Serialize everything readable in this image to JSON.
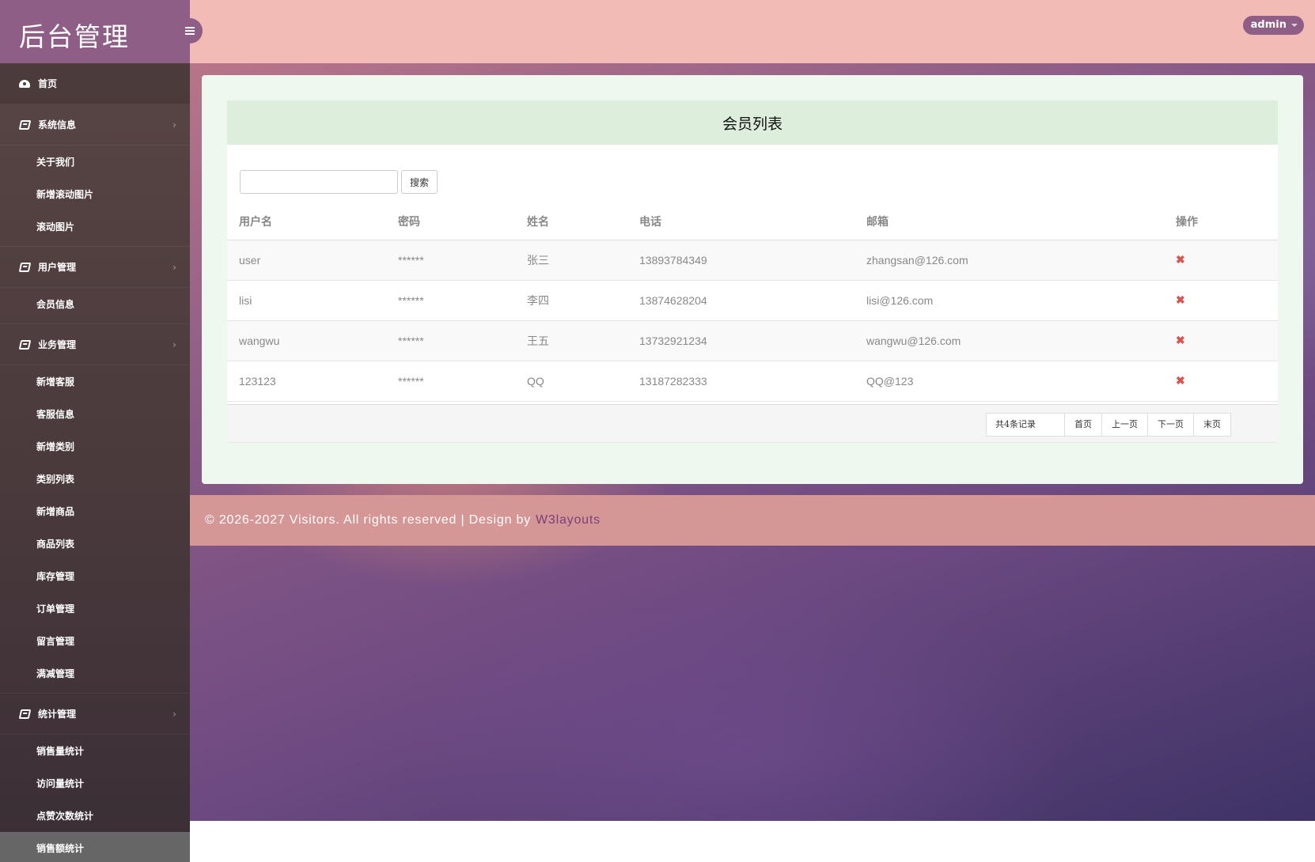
{
  "brand": "后台管理",
  "header": {
    "user": "admin"
  },
  "nav": {
    "home": "首页",
    "groups": [
      {
        "label": "系统信息",
        "items": [
          "关于我们",
          "新增滚动图片",
          "滚动图片"
        ]
      },
      {
        "label": "用户管理",
        "items": [
          "会员信息"
        ]
      },
      {
        "label": "业务管理",
        "items": [
          "新增客服",
          "客服信息",
          "新增类别",
          "类别列表",
          "新增商品",
          "商品列表",
          "库存管理",
          "订单管理",
          "留言管理",
          "满减管理"
        ]
      },
      {
        "label": "统计管理",
        "items": [
          "销售量统计",
          "访问量统计",
          "点赞次数统计",
          "销售额统计"
        ]
      }
    ]
  },
  "card": {
    "title": "会员列表",
    "search_button": "搜索",
    "search_placeholder": "",
    "columns": [
      "用户名",
      "密码",
      "姓名",
      "电话",
      "邮箱",
      "操作"
    ],
    "rows": [
      [
        "user",
        "******",
        "张三",
        "13893784349",
        "zhangsan@126.com"
      ],
      [
        "lisi",
        "******",
        "李四",
        "13874628204",
        "lisi@126.com"
      ],
      [
        "wangwu",
        "******",
        "王五",
        "13732921234",
        "wangwu@126.com"
      ],
      [
        "123123",
        "******",
        "QQ",
        "13187282333",
        "QQ@123"
      ]
    ],
    "delete_symbol": "✖"
  },
  "pager": {
    "count": "共4条记录",
    "first": "首页",
    "prev": "上一页",
    "next": "下一页",
    "last": "末页"
  },
  "footer": {
    "text": "© 2026-2027 Visitors. All rights reserved | Design by",
    "link": "W3layouts",
    "link_color": "#7b3f7a"
  },
  "colors": {
    "brand_bg": "#8e5e87",
    "header_bg": "#f2bbb5",
    "footer_bg": "#d49796",
    "delete": "#d9534f"
  }
}
